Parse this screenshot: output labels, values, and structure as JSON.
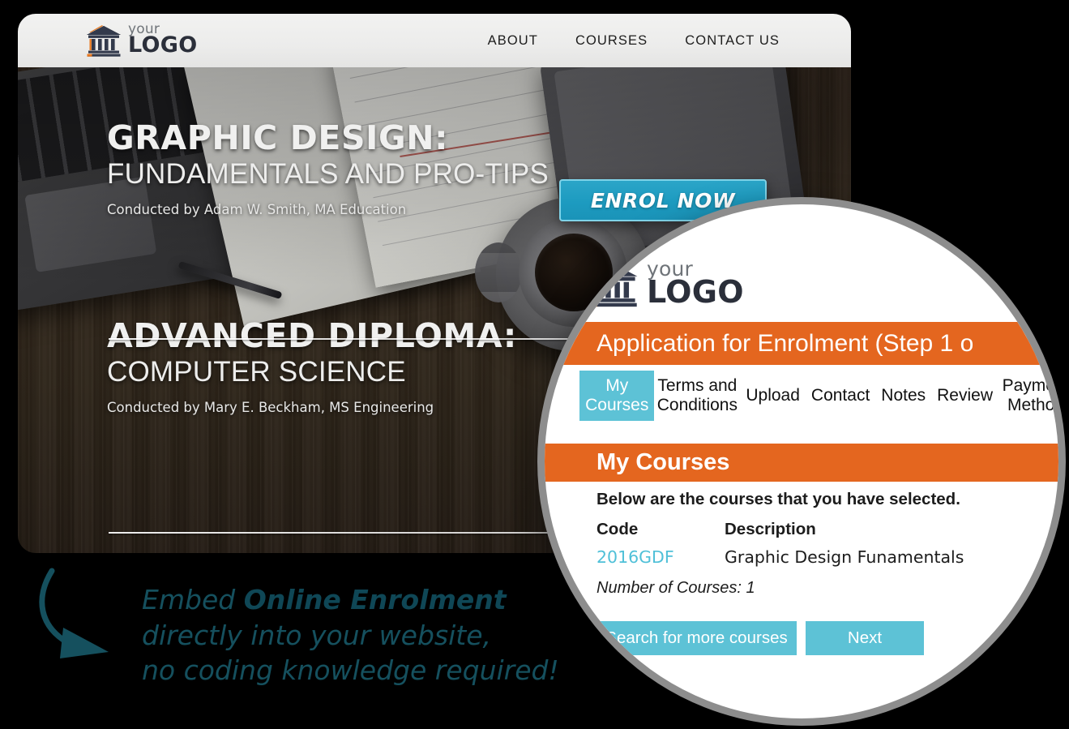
{
  "site": {
    "logo": {
      "line1": "your",
      "line2": "LOGO",
      "icon": "bank-building-icon"
    },
    "nav": [
      {
        "label": "ABOUT"
      },
      {
        "label": "COURSES"
      },
      {
        "label": "CONTACT US"
      }
    ],
    "hero": {
      "cta": {
        "label": "ENROL NOW"
      },
      "courses": [
        {
          "title": "GRAPHIC DESIGN:",
          "subtitle": "FUNDAMENTALS AND PRO-TIPS",
          "conductor": "Conducted by Adam W. Smith, MA Education"
        },
        {
          "title": "ADVANCED DIPLOMA:",
          "subtitle": "COMPUTER SCIENCE",
          "conductor": "Conducted by Mary E. Beckham, MS Engineering"
        }
      ]
    }
  },
  "tagline": {
    "line1_pre": "Embed ",
    "line1_bold": "Online Enrolment",
    "line2": "directly into your website,",
    "line3": "no coding knowledge required!"
  },
  "magnifier": {
    "logo": {
      "line1": "your",
      "line2": "LOGO",
      "icon": "bank-building-icon"
    },
    "app_title": "Application for Enrolment (Step 1 o",
    "tabs": [
      {
        "label": "My Courses",
        "active": true
      },
      {
        "label": "Terms and Conditions",
        "active": false
      },
      {
        "label": "Upload",
        "active": false
      },
      {
        "label": "Contact",
        "active": false
      },
      {
        "label": "Notes",
        "active": false
      },
      {
        "label": "Review",
        "active": false
      },
      {
        "label": "Payment Method",
        "active": false
      }
    ],
    "section_title": "My Courses",
    "lead": "Below are the courses that you have selected.",
    "table": {
      "headers": {
        "code": "Code",
        "description": "Description"
      },
      "rows": [
        {
          "code": "2016GDF",
          "description": "Graphic Design Funamentals"
        }
      ]
    },
    "count": "Number of Courses: 1",
    "buttons": {
      "search": "Search for more courses",
      "next": "Next"
    }
  },
  "colors": {
    "orange": "#e4661f",
    "teal": "#5dc2d6",
    "cta_blue": "#1d9bc0",
    "tagline_teal": "#15505e",
    "link_teal": "#4fc0d8"
  }
}
